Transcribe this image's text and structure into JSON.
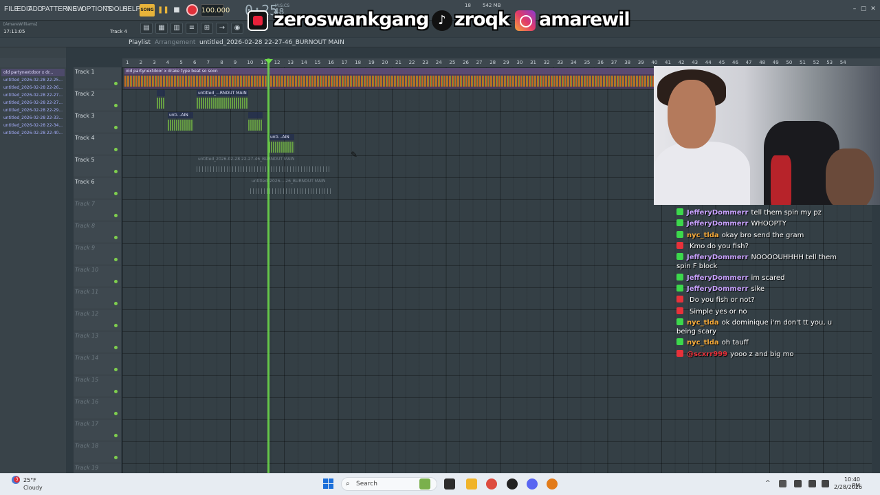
{
  "menu": {
    "items": [
      "FILE",
      "EDIT",
      "ADD",
      "PATTERNS",
      "VIEW",
      "OPTIONS",
      "TOOLS",
      "HELP"
    ]
  },
  "transport": {
    "song_label": "SONG",
    "pause_icon": "pause-icon",
    "stop_icon": "stop-icon",
    "record_icon": "record-icon",
    "tempo": "100.000",
    "time_main": "0:25",
    "time_sub": "M:S:CS",
    "time_cs": "48"
  },
  "perf": {
    "cpu": "18",
    "memory": "542 MB"
  },
  "banner": {
    "kick_handle": "zeroswankgang",
    "tiktok_handle": "zroqk",
    "instagram_handle": "amarewil",
    "tiktok_glyph": "♪"
  },
  "status": {
    "user": "[AmareWilliams]",
    "clock": "17:11:05",
    "track_hint": "Track 4"
  },
  "playlist": {
    "title": "Playlist",
    "subtitle": "Arrangement",
    "file": "untitled_2026-02-28 22-27-46_BURNOUT MAIN"
  },
  "picker": {
    "items": [
      "old partynextdoor x dr...",
      "untitled_2026-02-28 22-25...",
      "untitled_2026-02-28 22-26...",
      "untitled_2026-02-28 22-27...",
      "untitled_2026-02-28 22-27...",
      "untitled_2026-02-28 22-29...",
      "untitled_2026-02-28 22-33...",
      "untitled_2026-02-28 22-34...",
      "untitled_2026-02-28 22-40..."
    ]
  },
  "tracks": [
    "Track 1",
    "Track 2",
    "Track 3",
    "Track 4",
    "Track 5",
    "Track 6",
    "Track 7",
    "Track 8",
    "Track 9",
    "Track 10",
    "Track 11",
    "Track 12",
    "Track 13",
    "Track 14",
    "Track 15",
    "Track 16",
    "Track 17",
    "Track 18",
    "Track 19"
  ],
  "ruler": [
    "1",
    "2",
    "3",
    "4",
    "5",
    "6",
    "7",
    "8",
    "9",
    "10",
    "11",
    "12",
    "13",
    "14",
    "15",
    "16",
    "17",
    "18",
    "19",
    "20",
    "21",
    "22",
    "23",
    "24",
    "25",
    "26",
    "27",
    "28",
    "29",
    "30",
    "31",
    "32",
    "33",
    "34",
    "35",
    "36",
    "37",
    "38",
    "39",
    "40",
    "41",
    "42",
    "43",
    "44",
    "45",
    "46",
    "47",
    "48",
    "49",
    "50",
    "51",
    "52",
    "53",
    "54"
  ],
  "clips": {
    "main": "old partynextdoor x drake type beat so soon",
    "c2a": "",
    "c2b": "untitled_...RNOUT MAIN",
    "c3a": "unti...AIN",
    "c3b": "",
    "c4": "unti...AIN",
    "c5": "untitled_2026-02-28 22-27-46_BURNOUT MAIN",
    "c6": "untitled_2026-...26_BURNOUT MAIN"
  },
  "chat": [
    {
      "platform": "kick",
      "user": "JefferyDommerr",
      "color": "#c9a2ff",
      "msg": "tell them spin my pz"
    },
    {
      "platform": "kick",
      "user": "JefferyDommerr",
      "color": "#c9a2ff",
      "msg": "WHOOPTY"
    },
    {
      "platform": "kick",
      "user": "nyc_tlda",
      "color": "#f2a83a",
      "msg": "okay bro send the gram"
    },
    {
      "platform": "youtube",
      "user": "",
      "color": "#e8313a",
      "msg": "Kmo do you fish?"
    },
    {
      "platform": "kick",
      "user": "JefferyDommerr",
      "color": "#c9a2ff",
      "msg": "NOOOOUHHHH tell them spin F block"
    },
    {
      "platform": "kick",
      "user": "JefferyDommerr",
      "color": "#c9a2ff",
      "msg": "im scared"
    },
    {
      "platform": "kick",
      "user": "JefferyDommerr",
      "color": "#c9a2ff",
      "msg": "sike"
    },
    {
      "platform": "youtube",
      "user": "",
      "color": "#e8313a",
      "msg": "Do you fish or not?"
    },
    {
      "platform": "youtube",
      "user": "",
      "color": "#e8313a",
      "msg": "Simple yes or no"
    },
    {
      "platform": "kick",
      "user": "nyc_tlda",
      "color": "#f2a83a",
      "msg": "ok dominique i'm don't tt you, u being scary"
    },
    {
      "platform": "kick",
      "user": "nyc_tlda",
      "color": "#f2a83a",
      "msg": "oh tauff"
    },
    {
      "platform": "youtube",
      "user": "@scxrr999",
      "color": "#e8313a",
      "msg": "yooo z and big mo"
    }
  ],
  "taskbar": {
    "weather_badge": "3",
    "temp": "25°F",
    "condition": "Cloudy",
    "search_icon": "⌕",
    "search_placeholder": "Search",
    "tray_up": "^",
    "time": "10:40 PM",
    "date": "2/28/2026"
  },
  "colors": {
    "accent_green": "#6fe04a",
    "kick_green": "#3cd84c",
    "youtube_red": "#e8313a"
  }
}
